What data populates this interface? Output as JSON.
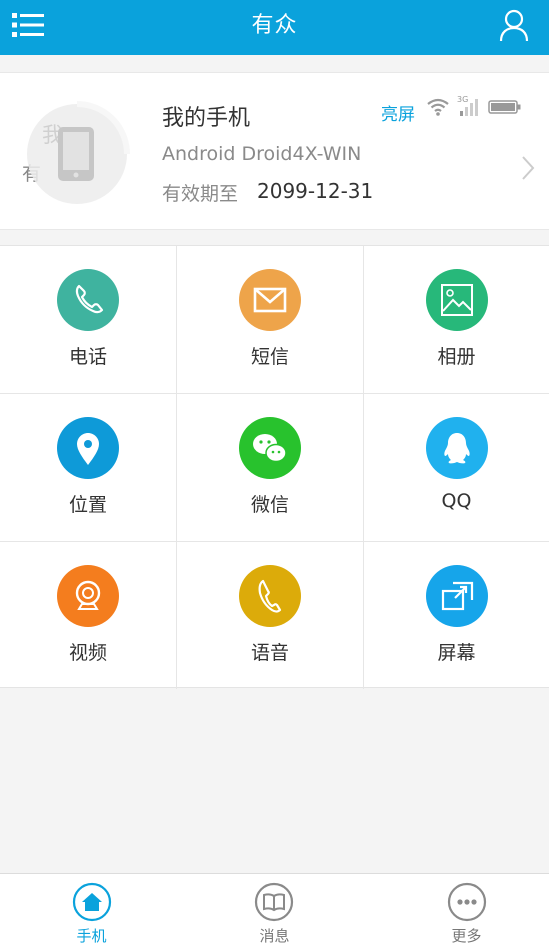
{
  "header": {
    "title": "有众",
    "menu_icon": "list-menu-icon",
    "user_icon": "user-icon",
    "color": "#0aa2dc"
  },
  "device": {
    "avatar_text_1": "我",
    "avatar_text_2": "有",
    "name": "我的手机",
    "model": "Android Droid4X-WIN",
    "valid_label": "有效期至",
    "valid_date": "2099-12-31",
    "screen_status": "亮屏",
    "signal_label": "3G"
  },
  "features": [
    {
      "label": "电话",
      "icon": "phone-icon",
      "color": "#3fb39f"
    },
    {
      "label": "短信",
      "icon": "envelope-icon",
      "color": "#eea44a"
    },
    {
      "label": "相册",
      "icon": "photo-icon",
      "color": "#27b87a"
    },
    {
      "label": "位置",
      "icon": "location-pin-icon",
      "color": "#0e9ad8"
    },
    {
      "label": "微信",
      "icon": "wechat-icon",
      "color": "#28c22d"
    },
    {
      "label": "QQ",
      "icon": "qq-penguin-icon",
      "color": "#20b1ee"
    },
    {
      "label": "视频",
      "icon": "webcam-icon",
      "color": "#f47d1e"
    },
    {
      "label": "语音",
      "icon": "handset-icon",
      "color": "#dcab0a"
    },
    {
      "label": "屏幕",
      "icon": "screen-share-icon",
      "color": "#16a5ea"
    }
  ],
  "tabs": [
    {
      "label": "手机",
      "icon": "home-icon",
      "active": true
    },
    {
      "label": "消息",
      "icon": "book-icon",
      "active": false
    },
    {
      "label": "更多",
      "icon": "more-icon",
      "active": false
    }
  ]
}
